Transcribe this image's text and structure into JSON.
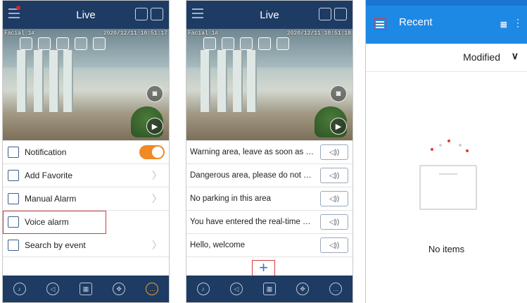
{
  "panel1": {
    "title": "Live",
    "video_caption_left": "Facial 1#",
    "video_caption_right": "2020/12/11 10:51:17",
    "menu": [
      {
        "label": "Notification",
        "icon": "notification-icon",
        "control": "toggle",
        "toggle_on": true
      },
      {
        "label": "Add Favorite",
        "icon": "star-icon"
      },
      {
        "label": "Manual Alarm",
        "icon": "alarm-icon"
      },
      {
        "label": "Voice alarm",
        "icon": "voice-alarm-icon",
        "highlighted": true
      },
      {
        "label": "Search by event",
        "icon": "calendar-icon"
      }
    ]
  },
  "panel2": {
    "title": "Live",
    "video_caption_left": "Facial 1#",
    "video_caption_right": "2020/12/11 10:51:18",
    "messages": [
      "Warning area, leave as soon as possible",
      "Dangerous area, please do not approach",
      "No parking in this area",
      "You have entered the real-time monitoring area",
      "Hello, welcome"
    ],
    "add_label": "+"
  },
  "panel3": {
    "title": "Recent",
    "sort_label": "Modified",
    "empty_text": "No items"
  },
  "colors": {
    "app_bar": "#1e3b63",
    "toggle": "#f08a24",
    "highlight": "#d63b3b",
    "files_bar": "#1e88e5"
  }
}
